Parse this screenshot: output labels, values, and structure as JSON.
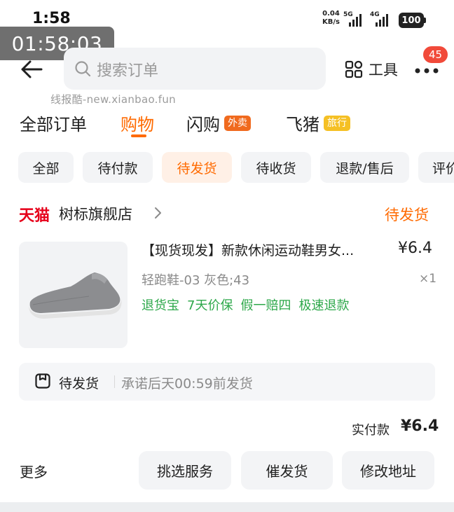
{
  "status_bar": {
    "time": "1:58",
    "timer_overlay": "01:58:03",
    "net_speed_value": "0.04",
    "net_speed_unit": "KB/s",
    "signal_1": "5G",
    "signal_2": "4G",
    "battery": "100"
  },
  "header": {
    "search_placeholder": "搜索订单",
    "tools_label": "工具",
    "message_badge": "45",
    "watermark": "线报酷-new.xianbao.fun"
  },
  "category_tabs": [
    {
      "label": "全部订单"
    },
    {
      "label": "购物"
    },
    {
      "label": "闪购",
      "tag": "外卖"
    },
    {
      "label": "飞猪",
      "tag": "旅行"
    }
  ],
  "filter_chips": [
    {
      "label": "全部"
    },
    {
      "label": "待付款"
    },
    {
      "label": "待发货"
    },
    {
      "label": "待收货"
    },
    {
      "label": "退款/售后"
    },
    {
      "label": "评价"
    }
  ],
  "order": {
    "platform": "天猫",
    "store_name": "树标旗舰店",
    "status": "待发货",
    "product": {
      "title": "【现货现发】新款休闲运动鞋男女...",
      "price": "¥6.4",
      "spec": "轻跑鞋-03 灰色;43",
      "quantity": "×1",
      "service_tags": [
        "退货宝",
        "7天价保",
        "假一赔四",
        "极速退款"
      ]
    },
    "shipping": {
      "title": "待发货",
      "promise": "承诺后天00:59前发货"
    },
    "paid_label": "实付款",
    "paid_amount": "¥6.4"
  },
  "actions": {
    "more_label": "更多",
    "buttons": [
      "挑选服务",
      "催发货",
      "修改地址"
    ]
  },
  "colors": {
    "accent": "#ff6a00",
    "service_green": "#2da84a",
    "tmall_red": "#e6001a",
    "badge_red": "#f14a3a",
    "waimai_tag": "#f06a1e",
    "lvxing_tag": "#f5c024"
  },
  "icons": {
    "back": "arrow-left-icon",
    "search": "search-icon",
    "tools": "grid-icon",
    "more": "more-dots-icon",
    "store": "chevron-right-icon",
    "shipping": "package-icon"
  }
}
